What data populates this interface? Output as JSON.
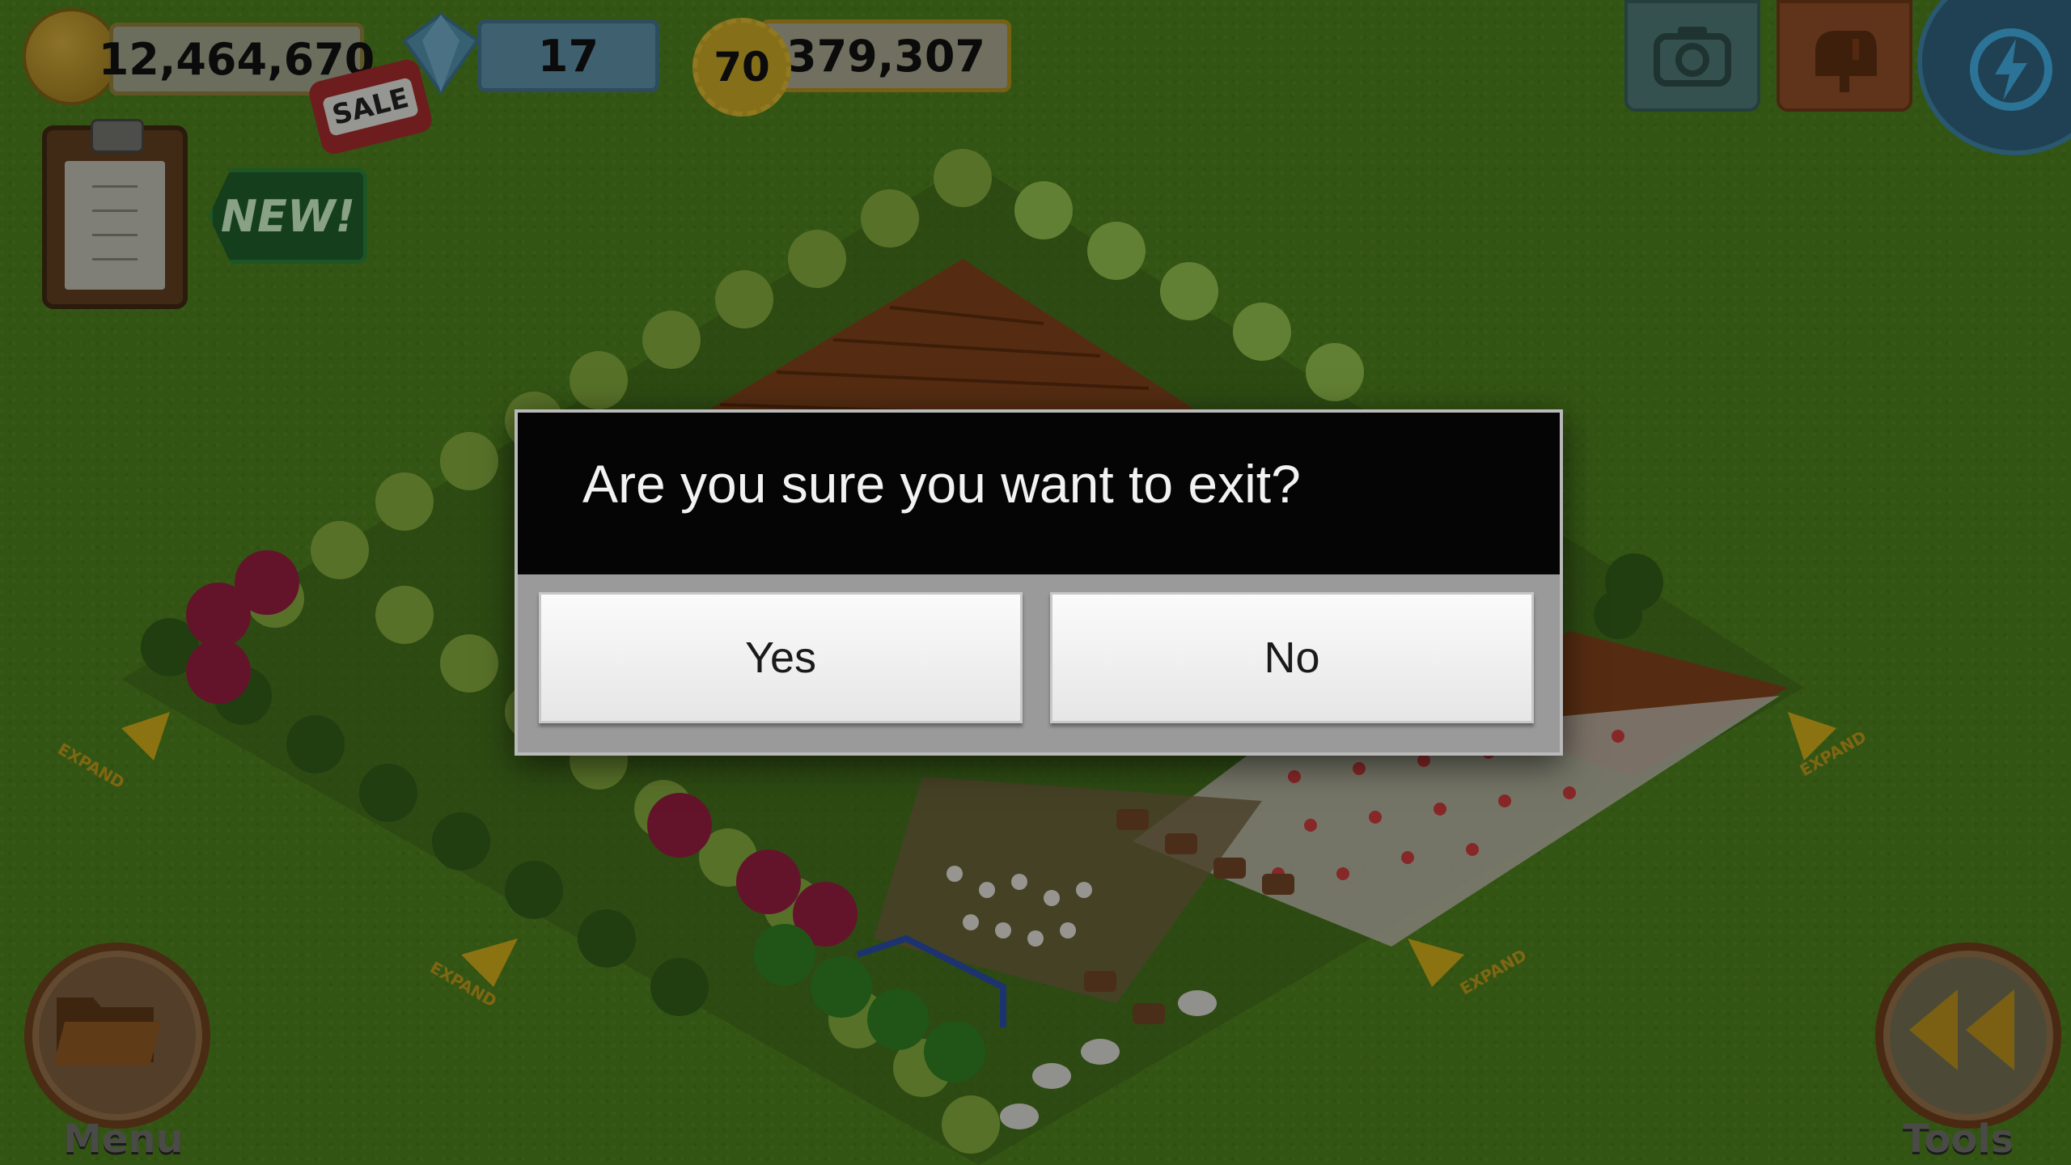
{
  "hud": {
    "coins": "12,464,670",
    "gems": "17",
    "level": "70",
    "xp": "379,307"
  },
  "badges": {
    "sale": "SALE",
    "new": "NEW!"
  },
  "buttons": {
    "menu_label": "Menu",
    "tools_label": "Tools"
  },
  "map": {
    "expand_label": "EXPAND"
  },
  "dialog": {
    "message": "Are you sure you want to exit?",
    "yes_label": "Yes",
    "no_label": "No"
  },
  "icons": {
    "coin": "coin-icon",
    "gem": "gem-icon",
    "camera": "camera-icon",
    "mailbox": "mailbox-icon",
    "energy": "energy-icon",
    "folder": "folder-icon",
    "rewind": "rewind-icon",
    "clipboard": "clipboard-icon"
  },
  "colors": {
    "grass": "#4a7a1c",
    "dialog_header": "#050505",
    "dialog_body": "#9a9a9a"
  }
}
